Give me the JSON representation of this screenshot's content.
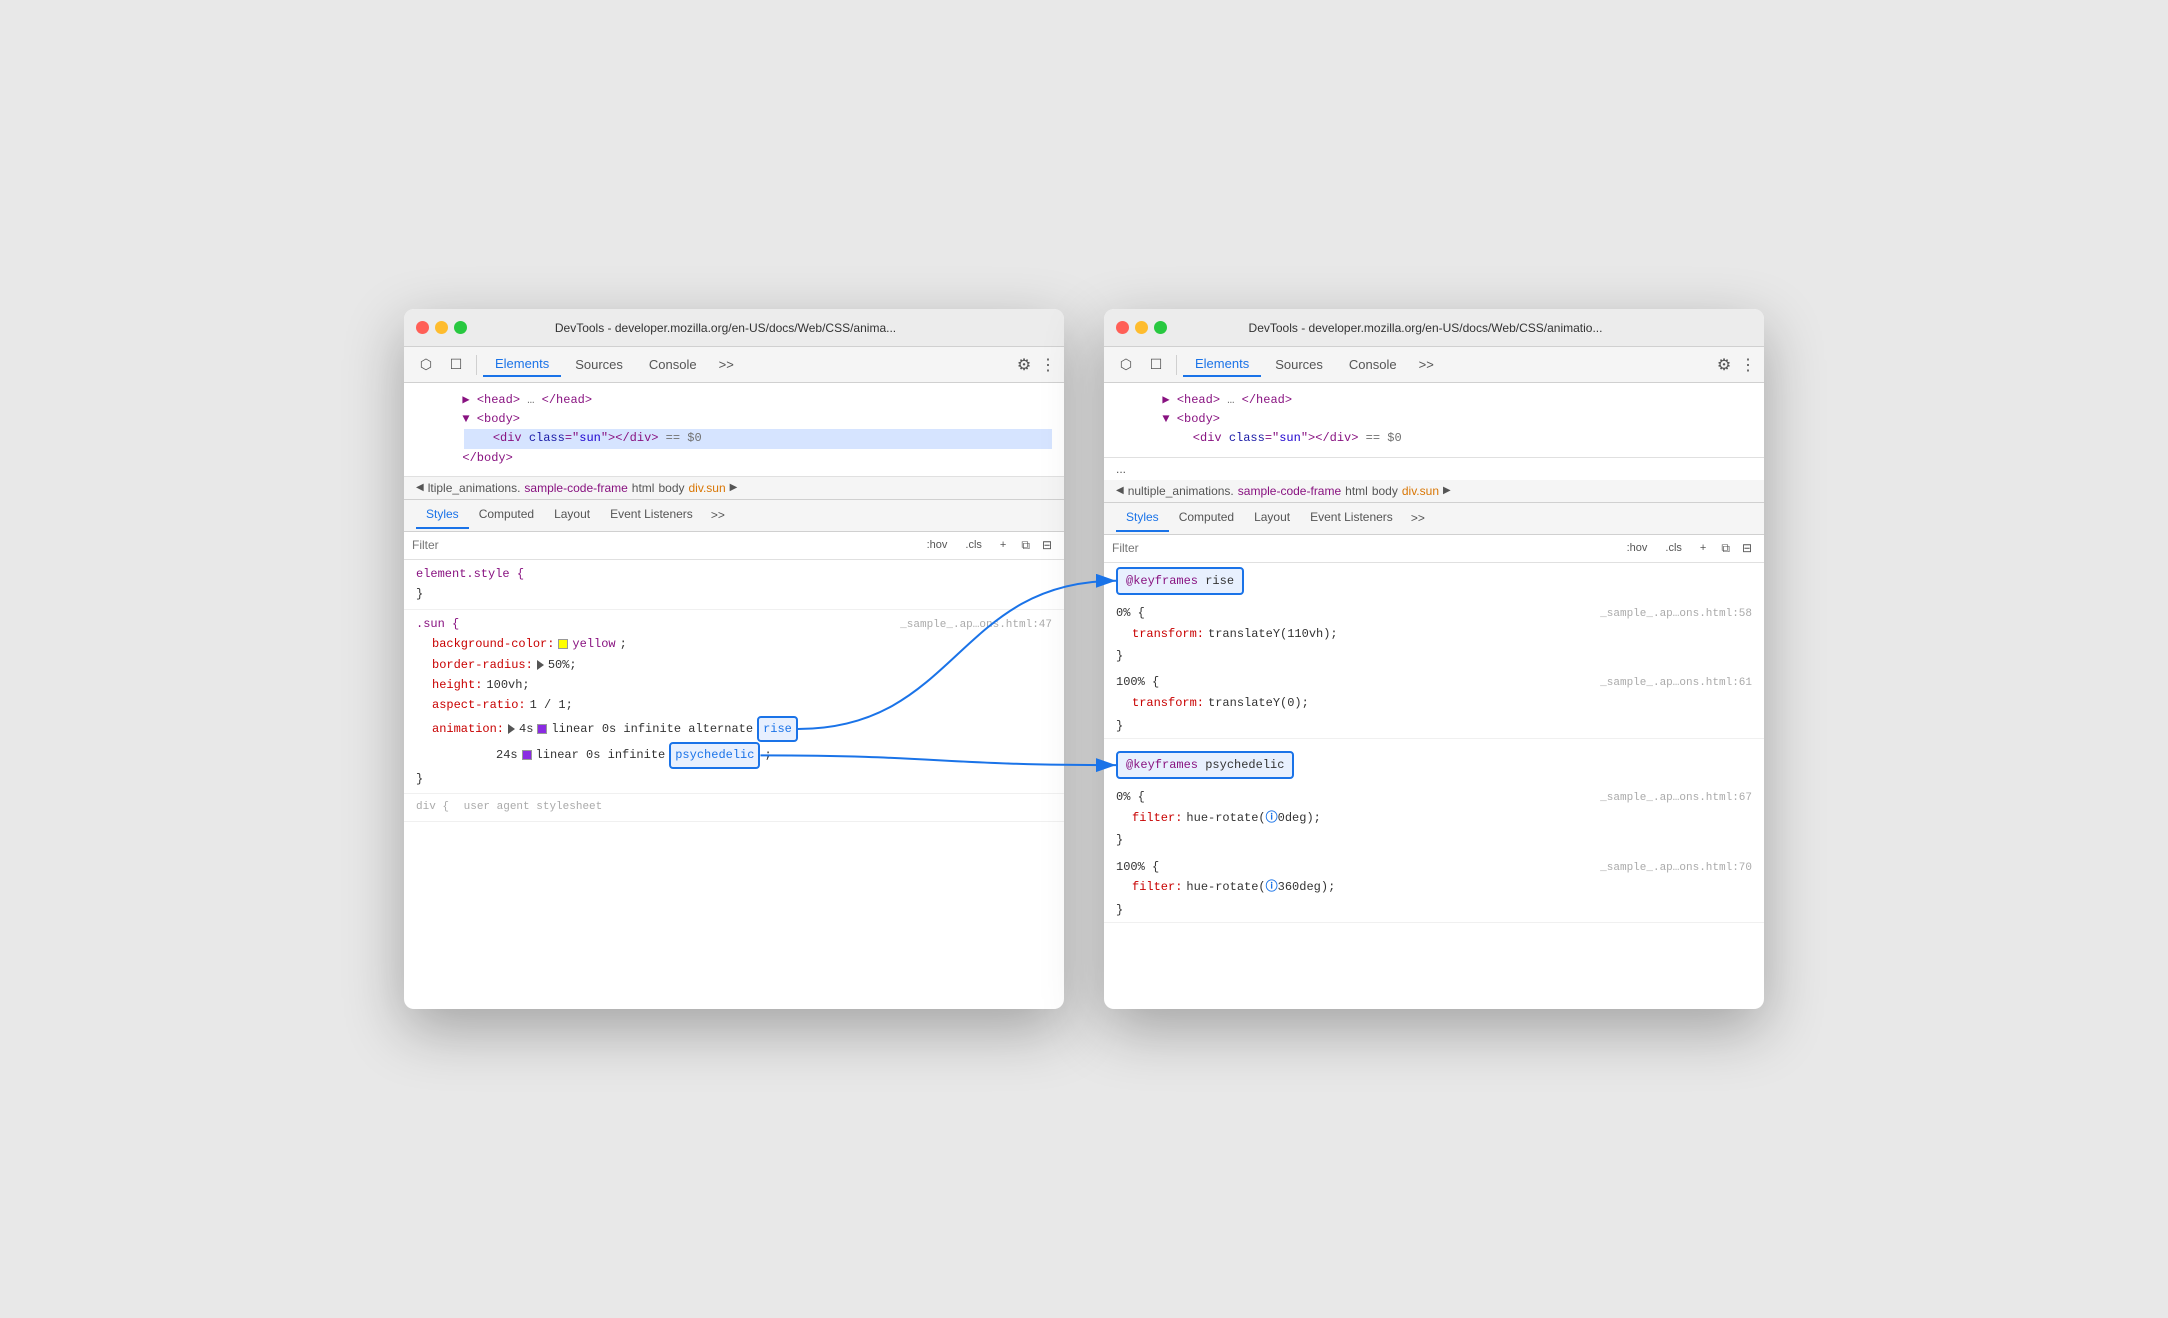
{
  "window1": {
    "titlebar": {
      "title": "DevTools - developer.mozilla.org/en-US/docs/Web/CSS/anima..."
    },
    "toolbar": {
      "tabs": [
        "Elements",
        "Sources",
        "Console"
      ],
      "more": ">>",
      "active": "Elements"
    },
    "html_tree": {
      "lines": [
        {
          "indent": 2,
          "content": "▶ <head> … </head>",
          "selected": false
        },
        {
          "indent": 2,
          "content": "▼ <body>",
          "selected": false
        },
        {
          "indent": 3,
          "content": "<div class=\"sun\"></div>  == $0",
          "selected": true
        },
        {
          "indent": 2,
          "content": "</body>",
          "selected": false
        }
      ]
    },
    "breadcrumb": {
      "prefix": "◀ ltiple_animations.",
      "link": "sample-code-frame",
      "items": [
        "html",
        "body",
        "div.sun"
      ],
      "suffix": "▶"
    },
    "panel_tabs": [
      "Styles",
      "Computed",
      "Layout",
      "Event Listeners",
      ">>"
    ],
    "active_panel_tab": "Styles",
    "filter": {
      "placeholder": "Filter",
      "hov": ":hov",
      "cls": ".cls",
      "plus": "+",
      "icons": [
        "copy-icon",
        "sidebar-icon"
      ]
    },
    "css_rules": [
      {
        "selector": "element.style {",
        "source": "",
        "lines": [
          {
            "prop": "",
            "colon": "",
            "val": ""
          }
        ],
        "close": "}"
      },
      {
        "selector": ".sun {",
        "source": "_sample_.ap…ons.html:47",
        "lines": [
          {
            "prop": "background-color:",
            "val": "yellow;",
            "has_swatch": true,
            "swatch_color": "yellow"
          },
          {
            "prop": "border-radius:",
            "val": "▶ 50%;",
            "has_triangle": true
          },
          {
            "prop": "height:",
            "val": "100vh;"
          },
          {
            "prop": "aspect-ratio:",
            "val": "1 / 1;"
          },
          {
            "prop": "animation:",
            "val": "▶ 4s",
            "val2": "linear 0s infinite alternate",
            "highlight": "rise",
            "has_triangle": true
          },
          {
            "prop": "",
            "val": "24s",
            "val2": "",
            "swatch_color": "#8a2be2",
            "has_swatch": true,
            "highlight": "psychedelic",
            "suffix": ";"
          }
        ],
        "close": "}"
      }
    ],
    "footer_dots": "...",
    "footer_label": "user agent stylesheet"
  },
  "window2": {
    "titlebar": {
      "title": "DevTools - developer.mozilla.org/en-US/docs/Web/CSS/animatio..."
    },
    "toolbar": {
      "tabs": [
        "Elements",
        "Sources",
        "Console"
      ],
      "more": ">>",
      "active": "Elements"
    },
    "html_tree": {
      "lines": [
        {
          "indent": 2,
          "content": "▶ <head> … </head>",
          "selected": false
        },
        {
          "indent": 2,
          "content": "▼ <body>",
          "selected": false
        },
        {
          "indent": 3,
          "content": "<div class=\"sun\"></div>  == $0",
          "selected": false
        }
      ]
    },
    "dots": "...",
    "breadcrumb": {
      "prefix": "◀ nultiple_animations.",
      "link": "sample-code-frame",
      "items": [
        "html",
        "body",
        "div.sun"
      ],
      "suffix": "▶"
    },
    "panel_tabs": [
      "Styles",
      "Computed",
      "Layout",
      "Event Listeners",
      ">>"
    ],
    "active_panel_tab": "Styles",
    "filter": {
      "placeholder": "Filter",
      "hov": ":hov",
      "cls": ".cls",
      "plus": "+",
      "icons": [
        "copy-icon",
        "sidebar-icon"
      ]
    },
    "keyframes": [
      {
        "name": "@keyframes rise",
        "highlighted": true,
        "source58": "_sample_.ap…ons.html:58",
        "pct0": "0% {",
        "prop0": "transform:",
        "val0": "translateY(110vh);",
        "close0": "}",
        "source61": "_sample_.ap…ons.html:61",
        "pct100": "100% {",
        "prop100": "transform:",
        "val100": "translateY(0);",
        "close100": "}"
      },
      {
        "name": "@keyframes psychedelic",
        "highlighted": true,
        "source67": "_sample_.ap…ons.html:67",
        "pct0": "0% {",
        "prop0": "filter:",
        "val0": "hue-rotate(",
        "circle_icon": "①",
        "val0b": "0deg);",
        "close0": "}",
        "source70": "_sample_.ap…ons.html:70",
        "pct100": "100% {",
        "prop100": "filter:",
        "val100": "hue-rotate(",
        "circle_icon2": "①",
        "val100b": "360deg);",
        "close100": "}"
      }
    ]
  },
  "icons": {
    "cursor": "⬡",
    "inspector": "□",
    "gear": "⚙",
    "more": "⋮"
  }
}
